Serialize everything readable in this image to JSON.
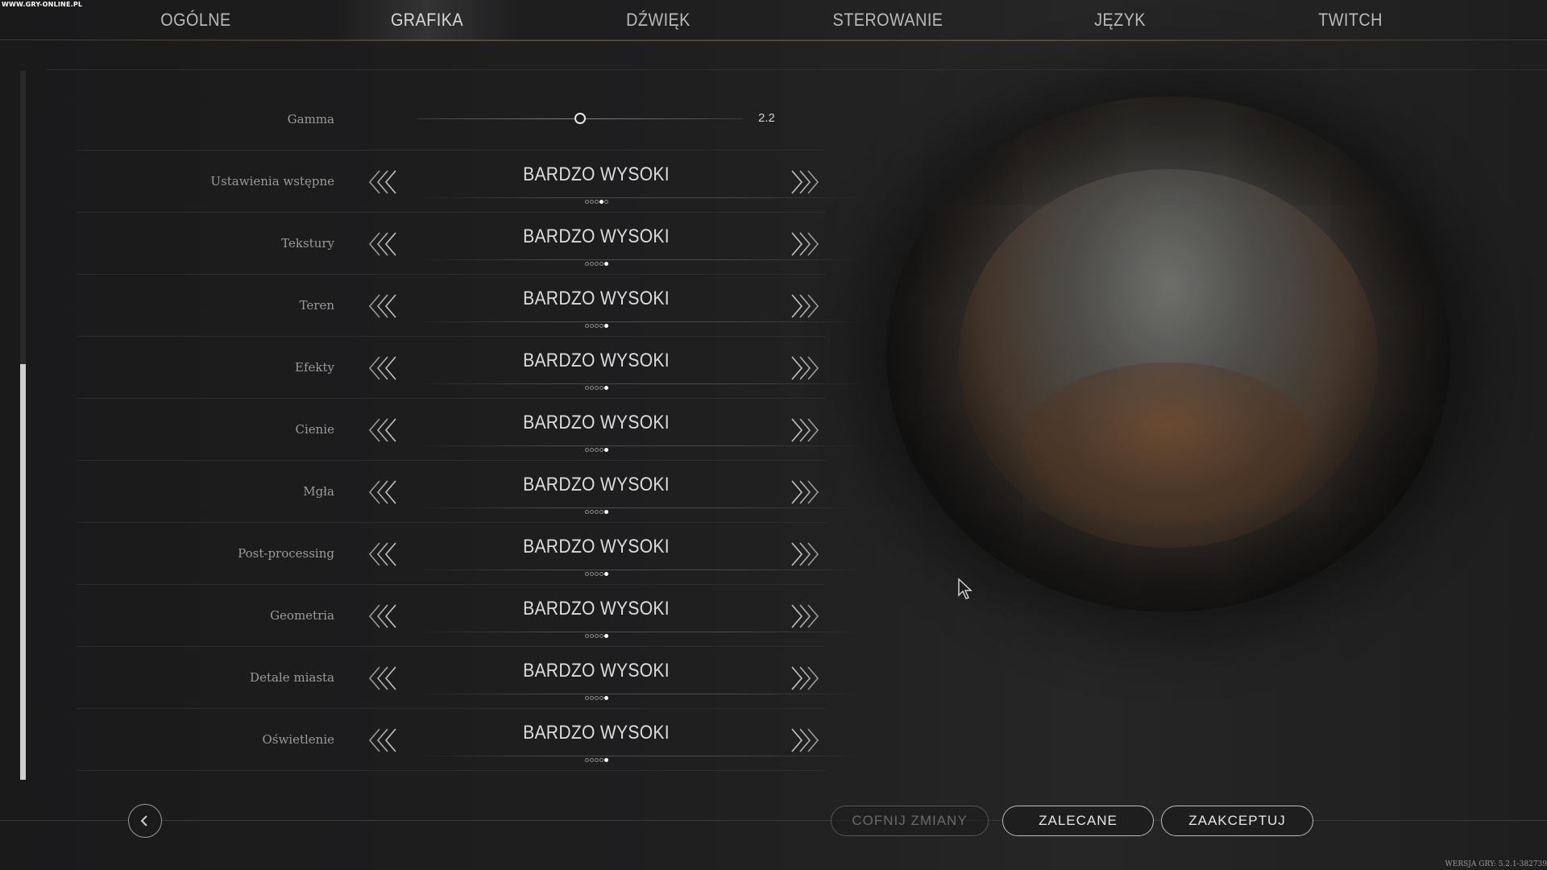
{
  "watermark": "WWW.GRY-ONLINE.PL",
  "tabs": [
    {
      "label": "OGÓLNE",
      "active": false
    },
    {
      "label": "GRAFIKA",
      "active": true
    },
    {
      "label": "DŹWIĘK",
      "active": false
    },
    {
      "label": "STEROWANIE",
      "active": false
    },
    {
      "label": "JĘZYK",
      "active": false
    },
    {
      "label": "TWITCH",
      "active": false
    }
  ],
  "gamma": {
    "label": "Gamma",
    "value": "2.2",
    "slider_fraction": 0.5
  },
  "settings": [
    {
      "label": "Ustawienia wstępne",
      "value": "BARDZO WYSOKI",
      "level": 4,
      "steps": 5
    },
    {
      "label": "Tekstury",
      "value": "BARDZO WYSOKI",
      "level": 5,
      "steps": 5
    },
    {
      "label": "Teren",
      "value": "BARDZO WYSOKI",
      "level": 5,
      "steps": 5
    },
    {
      "label": "Efekty",
      "value": "BARDZO WYSOKI",
      "level": 5,
      "steps": 5
    },
    {
      "label": "Cienie",
      "value": "BARDZO WYSOKI",
      "level": 5,
      "steps": 5
    },
    {
      "label": "Mgła",
      "value": "BARDZO WYSOKI",
      "level": 5,
      "steps": 5
    },
    {
      "label": "Post-processing",
      "value": "BARDZO WYSOKI",
      "level": 5,
      "steps": 5
    },
    {
      "label": "Geometria",
      "value": "BARDZO WYSOKI",
      "level": 5,
      "steps": 5
    },
    {
      "label": "Detale miasta",
      "value": "BARDZO WYSOKI",
      "level": 5,
      "steps": 5
    },
    {
      "label": "Oświetlenie",
      "value": "BARDZO WYSOKI",
      "level": 5,
      "steps": 5
    }
  ],
  "buttons": {
    "revert": "COFNIJ ZMIANY",
    "recommended": "ZALECANE",
    "accept": "ZAAKCEPTUJ"
  },
  "version": "WERSJA GRY: 5.2.1-382739",
  "colors": {
    "accent_line": "#8c7748",
    "active_dot": "#ffffff"
  }
}
